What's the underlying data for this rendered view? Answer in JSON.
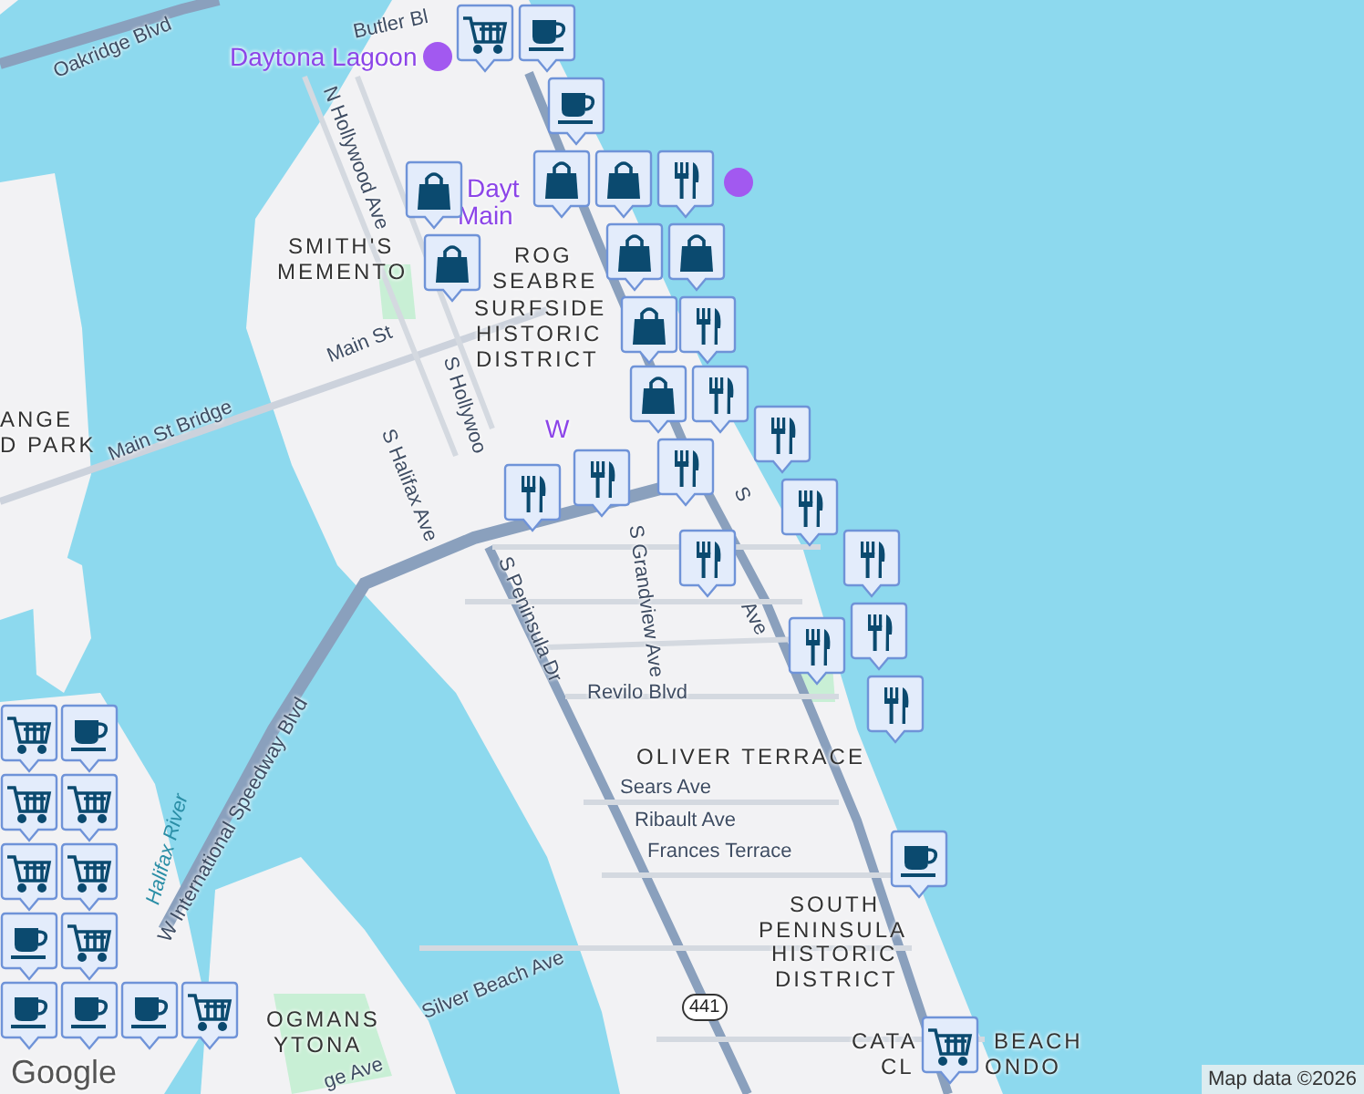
{
  "map": {
    "labels": [
      {
        "text": "Oakridge Blvd",
        "kind": "road"
      },
      {
        "text": "Butler Bl",
        "kind": "road"
      },
      {
        "text": "Daytona Lagoon",
        "kind": "poi"
      },
      {
        "text": "N Hollywood Ave",
        "kind": "road"
      },
      {
        "text": "Dayt",
        "kind": "poi"
      },
      {
        "text": "Main",
        "kind": "poi"
      },
      {
        "text": "SMITH'S",
        "kind": "area"
      },
      {
        "text": "MEMENTO",
        "kind": "area"
      },
      {
        "text": "ROG",
        "kind": "area"
      },
      {
        "text": "SEABRE",
        "kind": "area"
      },
      {
        "text": "SURFSIDE",
        "kind": "area"
      },
      {
        "text": "HISTORIC",
        "kind": "area"
      },
      {
        "text": "DISTRICT",
        "kind": "area"
      },
      {
        "text": "Main St",
        "kind": "road"
      },
      {
        "text": "Main St Bridge",
        "kind": "road"
      },
      {
        "text": "ANGE",
        "kind": "area"
      },
      {
        "text": "D PARK",
        "kind": "area"
      },
      {
        "text": "S Halifax Ave",
        "kind": "road"
      },
      {
        "text": "S Hollywoo",
        "kind": "road"
      },
      {
        "text": "W",
        "kind": "poi"
      },
      {
        "text": "S Peninsula Dr",
        "kind": "road"
      },
      {
        "text": "S Grandview Ave",
        "kind": "road"
      },
      {
        "text": "S",
        "kind": "road"
      },
      {
        "text": "Ave",
        "kind": "road"
      },
      {
        "text": "Revilo Blvd",
        "kind": "road"
      },
      {
        "text": "OLIVER TERRACE",
        "kind": "area"
      },
      {
        "text": "Sears Ave",
        "kind": "road"
      },
      {
        "text": "Ribault Ave",
        "kind": "road"
      },
      {
        "text": "Frances Terrace",
        "kind": "road"
      },
      {
        "text": "SOUTH",
        "kind": "area"
      },
      {
        "text": "PENINSULA",
        "kind": "area"
      },
      {
        "text": "HISTORIC",
        "kind": "area"
      },
      {
        "text": "DISTRICT",
        "kind": "area"
      },
      {
        "text": "Silver Beach Ave",
        "kind": "road"
      },
      {
        "text": "441",
        "kind": "shield"
      },
      {
        "text": "CATA",
        "kind": "area"
      },
      {
        "text": "BEACH",
        "kind": "area"
      },
      {
        "text": "CL",
        "kind": "area"
      },
      {
        "text": "ONDO",
        "kind": "area"
      },
      {
        "text": "Halifax River",
        "kind": "water"
      },
      {
        "text": "W International Speedway Blvd",
        "kind": "road"
      },
      {
        "text": "OGMANS",
        "kind": "area"
      },
      {
        "text": "YTONA",
        "kind": "area"
      },
      {
        "text": "ge Ave",
        "kind": "road"
      }
    ],
    "markers": [
      {
        "kind": "cart"
      },
      {
        "kind": "coffee"
      },
      {
        "kind": "coffee"
      },
      {
        "kind": "shop"
      },
      {
        "kind": "shop"
      },
      {
        "kind": "shop"
      },
      {
        "kind": "shop"
      },
      {
        "kind": "food"
      },
      {
        "kind": "shop"
      },
      {
        "kind": "shop"
      },
      {
        "kind": "shop"
      },
      {
        "kind": "food"
      },
      {
        "kind": "shop"
      },
      {
        "kind": "food"
      },
      {
        "kind": "food"
      },
      {
        "kind": "food"
      },
      {
        "kind": "food"
      },
      {
        "kind": "food"
      },
      {
        "kind": "food"
      },
      {
        "kind": "food"
      },
      {
        "kind": "food"
      },
      {
        "kind": "food"
      },
      {
        "kind": "food"
      },
      {
        "kind": "food"
      },
      {
        "kind": "coffee"
      },
      {
        "kind": "cart"
      },
      {
        "kind": "coffee"
      },
      {
        "kind": "cart"
      },
      {
        "kind": "cart"
      },
      {
        "kind": "cart"
      },
      {
        "kind": "cart"
      },
      {
        "kind": "cart"
      },
      {
        "kind": "coffee"
      },
      {
        "kind": "cart"
      },
      {
        "kind": "coffee"
      },
      {
        "kind": "coffee"
      },
      {
        "kind": "coffee"
      },
      {
        "kind": "cart"
      }
    ],
    "logo": "Google",
    "attribution": "Map data ©2026"
  }
}
